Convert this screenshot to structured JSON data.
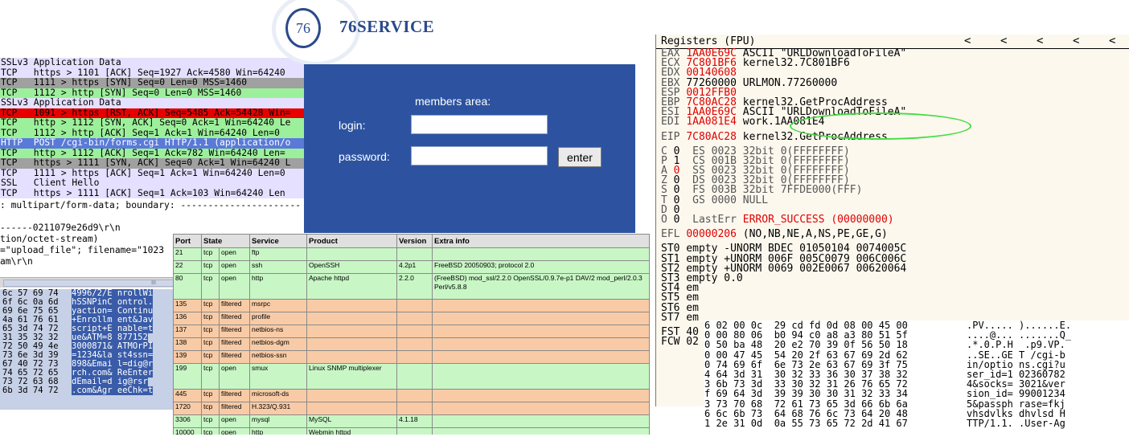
{
  "wireshark": {
    "packets": [
      {
        "style": "lav",
        "text": "SSLv3 Application Data"
      },
      {
        "style": "lav",
        "text": "TCP   https > 1101 [ACK] Seq=1927 Ack=4580 Win=64240"
      },
      {
        "style": "grey",
        "text": "TCP   1111 > https [SYN] Seq=0 Len=0 MSS=1460"
      },
      {
        "style": "green",
        "text": "TCP   1112 > http [SYN] Seq=0 Len=0 MSS=1460"
      },
      {
        "style": "lav",
        "text": "SSLv3 Application Data"
      },
      {
        "style": "red",
        "text": "TCP   1091 > https [RST, ACK] Seq=5485 Ack=54428 Win="
      },
      {
        "style": "green",
        "text": "TCP   http > 1112 [SYN, ACK] Seq=0 Ack=1 Win=64240 Le"
      },
      {
        "style": "green",
        "text": "TCP   1112 > http [ACK] Seq=1 Ack=1 Win=64240 Len=0"
      },
      {
        "style": "blue",
        "text": "HTTP  POST /cgi-bin/forms.cgi HTTP/1.1 (application/o"
      },
      {
        "style": "green",
        "text": "TCP   http > 1112 [ACK] Seq=1 Ack=782 Win=64240 Len="
      },
      {
        "style": "grey",
        "text": "TCP   https > 1111 [SYN, ACK] Seq=0 Ack=1 Win=64240 L"
      },
      {
        "style": "lav",
        "text": "TCP   1111 > https [ACK] Seq=1 Ack=1 Win=64240 Len=0"
      },
      {
        "style": "lav",
        "text": "SSL   Client Hello"
      },
      {
        "style": "lav",
        "text": "TCP   https > 1111 [ACK] Seq=1 Ack=103 Win=64240 Len"
      }
    ],
    "detail_lines": [
      ": multipart/form-data; boundary: ----------------------",
      "",
      "------0211079e26d9\\r\\n",
      "tion/octet-stream)",
      "=\"upload_file\"; filename=\"1023",
      "am\\r\\n"
    ],
    "scroll_grip": "III",
    "hex_rows": [
      {
        "hex": "6c 57 69 74",
        "ascii": "4996/2/E nrollWi"
      },
      {
        "hex": "6f 6c 0a 6d",
        "ascii": "hSSNPinC ontrol."
      },
      {
        "hex": "69 6e 75 65",
        "ascii": "yaction= Continu"
      },
      {
        "hex": "4a 61 76 61",
        "ascii": "+Enrollm ent&Jav"
      },
      {
        "hex": "65 3d 74 72",
        "ascii": "script+E nable=t"
      },
      {
        "hex": "31 35 32 32",
        "ascii": "ue&ATM=8 877152"
      },
      {
        "hex": "72 50 49 4e",
        "ascii": "3000871& ATMOrPI"
      },
      {
        "hex": "73 6e 3d 39",
        "ascii": "=1234&la st4ssn="
      },
      {
        "hex": "67 40 72 73",
        "ascii": "898&Emai l=dig@r"
      },
      {
        "hex": "74 65 72 65",
        "ascii": "rch.com& ReEnter"
      },
      {
        "hex": "73 72 63 68",
        "ascii": "dEmail=d ig@rsr"
      },
      {
        "hex": "6b 3d 74 72",
        "ascii": ".com&Agr eeChk=t"
      }
    ]
  },
  "login": {
    "logo_badge": "76",
    "brand": "76SERVICE",
    "members_area": "members area:",
    "login_label": "login:",
    "password_label": "password:",
    "login_value": "",
    "password_value": "",
    "enter_label": "enter"
  },
  "nmap": {
    "columns": [
      "Port",
      "State",
      "Service",
      "Product",
      "Version",
      "Extra info"
    ],
    "rows": [
      {
        "style": "open",
        "port": "21",
        "proto": "tcp",
        "state": "open",
        "service": "ftp",
        "product": "",
        "version": "",
        "extra": ""
      },
      {
        "style": "open",
        "port": "22",
        "proto": "tcp",
        "state": "open",
        "service": "ssh",
        "product": "OpenSSH",
        "version": "4.2p1",
        "extra": "FreeBSD 20050903; protocol 2.0"
      },
      {
        "style": "open",
        "port": "80",
        "proto": "tcp",
        "state": "open",
        "service": "http",
        "product": "Apache httpd",
        "version": "2.2.0",
        "extra": "(FreeBSD) mod_ssl/2.2.0 OpenSSL/0.9.7e-p1 DAV/2 mod_perl/2.0.3 Perl/v5.8.8"
      },
      {
        "style": "filt",
        "port": "135",
        "proto": "tcp",
        "state": "filtered",
        "service": "msrpc",
        "product": "",
        "version": "",
        "extra": ""
      },
      {
        "style": "filt",
        "port": "136",
        "proto": "tcp",
        "state": "filtered",
        "service": "profile",
        "product": "",
        "version": "",
        "extra": ""
      },
      {
        "style": "filt",
        "port": "137",
        "proto": "tcp",
        "state": "filtered",
        "service": "netbios-ns",
        "product": "",
        "version": "",
        "extra": ""
      },
      {
        "style": "filt",
        "port": "138",
        "proto": "tcp",
        "state": "filtered",
        "service": "netbios-dgm",
        "product": "",
        "version": "",
        "extra": ""
      },
      {
        "style": "filt",
        "port": "139",
        "proto": "tcp",
        "state": "filtered",
        "service": "netbios-ssn",
        "product": "",
        "version": "",
        "extra": ""
      },
      {
        "style": "open",
        "port": "199",
        "proto": "tcp",
        "state": "open",
        "service": "smux",
        "product": "Linux SNMP multiplexer",
        "version": "",
        "extra": ""
      },
      {
        "style": "filt",
        "port": "445",
        "proto": "tcp",
        "state": "filtered",
        "service": "microsoft-ds",
        "product": "",
        "version": "",
        "extra": ""
      },
      {
        "style": "filt",
        "port": "1720",
        "proto": "tcp",
        "state": "filtered",
        "service": "H.323/Q.931",
        "product": "",
        "version": "",
        "extra": ""
      },
      {
        "style": "open",
        "port": "3306",
        "proto": "tcp",
        "state": "open",
        "service": "mysql",
        "product": "MySQL",
        "version": "4.1.18",
        "extra": ""
      },
      {
        "style": "open",
        "port": "10000",
        "proto": "tcp",
        "state": "open",
        "service": "http",
        "product": "Webmin httpd",
        "version": "",
        "extra": ""
      }
    ]
  },
  "registers": {
    "title": "Registers (FPU)",
    "chevrons": [
      "<",
      "<",
      "<",
      "<",
      "<"
    ],
    "gp": [
      {
        "name": "EAX",
        "value": "1AA0E69C",
        "comment": "ASCII \"URLDownloadToFileA\""
      },
      {
        "name": "ECX",
        "value": "7C801BF6",
        "comment": "kernel32.7C801BF6"
      },
      {
        "name": "EDX",
        "value": "00140608",
        "comment": ""
      },
      {
        "name": "EBX",
        "value": "77260000",
        "comment": "URLMON.77260000",
        "black": true
      },
      {
        "name": "ESP",
        "value": "0012FFB0",
        "comment": ""
      },
      {
        "name": "EBP",
        "value": "7C80AC28",
        "comment": "kernel32.GetProcAddress"
      },
      {
        "name": "ESI",
        "value": "1AA0E69C",
        "comment": "ASCII \"URLDownloadToFileA\""
      },
      {
        "name": "EDI",
        "value": "1AA081E4",
        "comment": "work.1AA081E4"
      }
    ],
    "eip": {
      "name": "EIP",
      "value": "7C80AC28",
      "comment": "kernel32.GetProcAddress"
    },
    "flags": [
      {
        "f": "C",
        "b": "0",
        "seg": "ES 0023 32bit 0(FFFFFFFF)"
      },
      {
        "f": "P",
        "b": "1",
        "seg": "CS 001B 32bit 0(FFFFFFFF)"
      },
      {
        "f": "A",
        "b": "0",
        "seg": "SS 0023 32bit 0(FFFFFFFF)",
        "redbit": true
      },
      {
        "f": "Z",
        "b": "0",
        "seg": "DS 0023 32bit 0(FFFFFFFF)"
      },
      {
        "f": "S",
        "b": "0",
        "seg": "FS 003B 32bit 7FFDE000(FFF)"
      },
      {
        "f": "T",
        "b": "0",
        "seg": "GS 0000 NULL"
      },
      {
        "f": "D",
        "b": "0",
        "seg": ""
      },
      {
        "f": "O",
        "b": "0",
        "seg": "LastErr"
      }
    ],
    "lasterr_value": "ERROR_SUCCESS (00000000)",
    "efl": {
      "name": "EFL",
      "value": "00000206",
      "comment": "(NO,NB,NE,A,NS,PE,GE,G)"
    },
    "fpu": [
      "ST0 empty -UNORM BDEC 01050104 0074005C",
      "ST1 empty +UNORM 006F 005C0079 006C006C",
      "ST2 empty +UNORM 0069 002E0067 00620064",
      "ST3 empty 0.0",
      "ST4 em",
      "ST5 em",
      "ST6 em",
      "ST7 em"
    ],
    "fst": "FST 40",
    "fcw": "FCW 02"
  },
  "hexdump": {
    "rows": [
      {
        "hex": "6 02 00 0c  29 cd fd 0d 08 00 45 00",
        "ascii": ".PV..... )......E."
      },
      {
        "hex": "0 00 80 06  b0 94 c0 a8 a3 80 51 5f",
        "ascii": "....@... .......Q_"
      },
      {
        "hex": "0 50 ba 48  20 e2 70 39 0f 56 50 18",
        "ascii": ".*.0.P.H  .p9.VP."
      },
      {
        "hex": "0 00 47 45  54 20 2f 63 67 69 2d 62",
        "ascii": "..SE..GE T /cgi-b"
      },
      {
        "hex": "0 74 69 6f  6e 73 2e 63 67 69 3f 75",
        "ascii": "in/optio ns.cgi?u"
      },
      {
        "hex": "4 64 3d 31  30 32 33 36 30 37 38 32",
        "ascii": "ser_id=1 02360782"
      },
      {
        "hex": "3 6b 73 3d  33 30 32 31 26 76 65 72",
        "ascii": "4&socks= 3021&ver"
      },
      {
        "hex": "f 69 64 3d  39 39 30 30 31 32 33 34",
        "ascii": "sion_id= 99001234"
      },
      {
        "hex": "3 73 70 68  72 61 73 65 3d 66 6b 6a",
        "ascii": "5&passph rase=fkj"
      },
      {
        "hex": "6 6c 6b 73  64 68 76 6c 73 64 20 48",
        "ascii": "vhsdvlks dhvlsd H"
      },
      {
        "hex": "1 2e 31 0d  0a 55 73 65 72 2d 41 67",
        "ascii": "TTP/1.1. .User-Ag"
      }
    ]
  },
  "colors": {
    "login_blue": "#2d53a0",
    "brand_blue": "#2b4a8b",
    "register_red": "#e00000",
    "highlight_oval": "#44dd44",
    "packet_green": "#9df09b",
    "packet_red": "#e80000",
    "packet_blue": "#5a7ad9"
  }
}
